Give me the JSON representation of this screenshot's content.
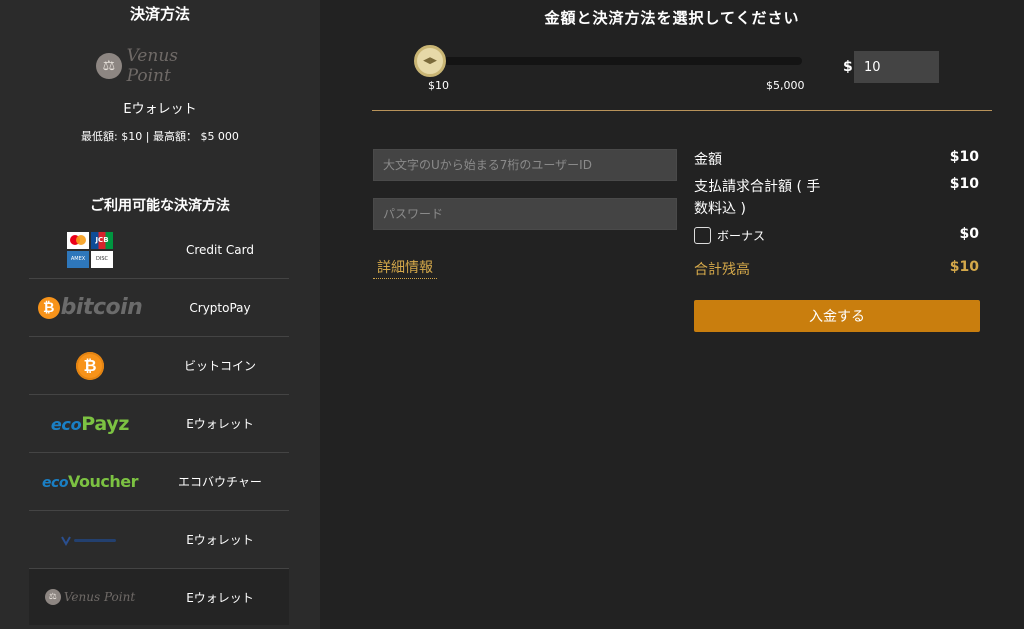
{
  "sidebar": {
    "title": "決済方法",
    "selected_logo_text": "Venus Point",
    "selected_name": "Eウォレット",
    "limits": "最低額: $10 | 最高額： $5 000",
    "available_title": "ご利用可能な決済方法",
    "methods": [
      {
        "logo": "credit-cards",
        "label": "Credit Card"
      },
      {
        "logo": "bitcoin-wordmark",
        "logo_text": "bitcoin",
        "label": "CryptoPay"
      },
      {
        "logo": "bitcoin-coin",
        "label": "ビットコイン"
      },
      {
        "logo": "ecopayz",
        "logo_text_a": "eco",
        "logo_text_b": "Payz",
        "label": "Eウォレット"
      },
      {
        "logo": "ecovoucher",
        "logo_text_a": "eco",
        "logo_text_b": "Voucher",
        "label": "エコバウチャー"
      },
      {
        "logo": "vwallet",
        "label": "Eウォレット"
      },
      {
        "logo": "venus-point",
        "logo_text": "Venus Point",
        "label": "Eウォレット"
      }
    ]
  },
  "main": {
    "title": "金額と決済方法を選択してください",
    "slider": {
      "min_label": "$10",
      "max_label": "$5,000",
      "fraction": 0.0
    },
    "currency_symbol": "$",
    "amount_value": "10",
    "userid_placeholder": "大文字のUから始まる7桁のユーザーID",
    "password_placeholder": "パスワード",
    "details_link": "詳細情報",
    "summary": {
      "amount_label": "金額",
      "amount_value": "$10",
      "total_label": "支払請求合計額 ( 手数料込 )",
      "total_value": "$10",
      "bonus_label": "ボーナス",
      "bonus_value": "$0",
      "balance_label": "合計残高",
      "balance_value": "$10"
    },
    "submit_label": "入金する"
  },
  "colors": {
    "accent_gold": "#d4a84a",
    "button_orange": "#c97e0e",
    "background": "#222222",
    "sidebar": "#2b2b2b"
  }
}
